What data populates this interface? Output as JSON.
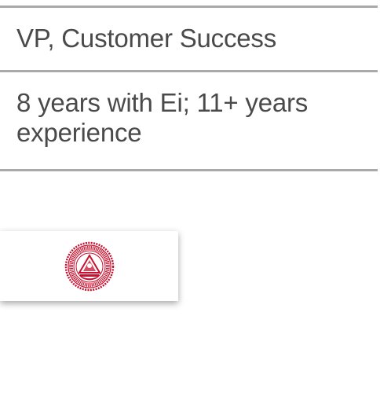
{
  "profile": {
    "title": "VP, Customer Success",
    "tenure": "8 years with Ei; 11+ years experience"
  },
  "logo": {
    "icon": "institute-seal-icon",
    "color": "#c8102e"
  }
}
